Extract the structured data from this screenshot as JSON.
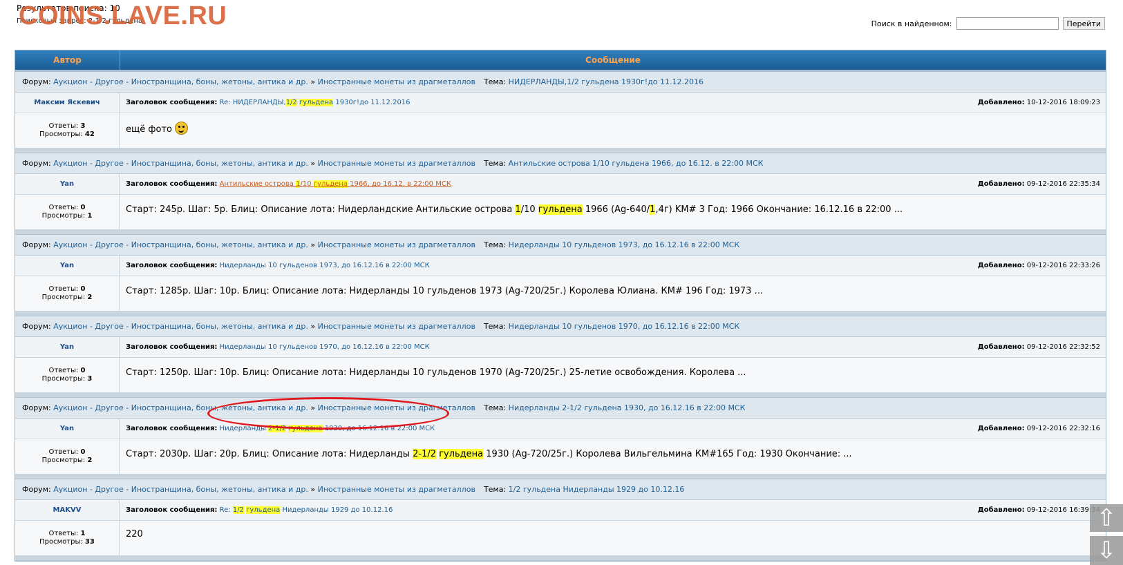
{
  "watermark": "COINS.LAVE.RU",
  "top": {
    "results": "Результатов поиска: 10",
    "query": "Поисковый запрос: 2-1/2 гульдена",
    "search_label": "Поиск в найденном:",
    "search_value": "",
    "search_button": "Перейти"
  },
  "table": {
    "col_author": "Автор",
    "col_message": "Сообщение"
  },
  "labels": {
    "forum": "Форум:",
    "topic": "Тема:",
    "subject": "Заголовок сообщения:",
    "added": "Добавлено:",
    "replies": "Ответы:",
    "views": "Просмотры:",
    "forum_path": "Аукцион - Другое - Иностранщина, боны, жетоны, антика и др.",
    "forum_sub": "Иностранные монеты из драгметаллов",
    "sep": "»"
  },
  "posts": [
    {
      "topic": "НИДЕРЛАНДЫ,1/2 гульдена 1930г!до 11.12.2016",
      "author": "Максим Яскевич",
      "subject_pre": "Re: НИДЕРЛАНДЫ,",
      "subject_hl1": "1/2",
      "subject_mid": " ",
      "subject_hl2": "гульдена",
      "subject_post": " 1930г!до 11.12.2016",
      "date": "10-12-2016 18:09:23",
      "replies": "3",
      "views": "42",
      "text": "ещё фото"
    },
    {
      "topic": "Антильские острова 1/10 гульдена 1966, до 16.12. в 22:00 МСК",
      "author": "Yan",
      "subject_a": "Антильские острова ",
      "subject_hl1": "1",
      "subject_b": "/10 ",
      "subject_hl2": "гульдена",
      "subject_c": " 1966, до 16.12. в 22:00 МСК",
      "date": "09-12-2016 22:35:34",
      "replies": "0",
      "views": "1",
      "text_a": "Старт: 245р. Шаг: 5р. Блиц: Описание лота: Нидерландские Антильские острова ",
      "text_hl1": "1",
      "text_b": "/10 ",
      "text_hl2": "гульдена",
      "text_c": " 1966 (Ag-640/",
      "text_hl3": "1",
      "text_d": ",4г) KM# 3 Год: 1966 Окончание: 16.12.16 в 22:00 ..."
    },
    {
      "topic": "Нидерланды 10 гульденов 1973, до 16.12.16 в 22:00 МСК",
      "author": "Yan",
      "subject": "Нидерланды 10 гульденов 1973, до 16.12.16 в 22:00 МСК",
      "date": "09-12-2016 22:33:26",
      "replies": "0",
      "views": "2",
      "text": "Старт: 1285р. Шаг: 10р. Блиц: Описание лота: Нидерланды 10 гульденов 1973 (Ag-720/25г.) Королева Юлиана. КМ# 196 Год: 1973 ..."
    },
    {
      "topic": "Нидерланды 10 гульденов 1970, до 16.12.16 в 22:00 МСК",
      "author": "Yan",
      "subject": "Нидерланды 10 гульденов 1970, до 16.12.16 в 22:00 МСК",
      "date": "09-12-2016 22:32:52",
      "replies": "0",
      "views": "3",
      "text": "Старт: 1250р. Шаг: 10р. Блиц: Описание лота: Нидерланды 10 гульденов 1970 (Ag-720/25г.) 25-летие освобождения. Королева ..."
    },
    {
      "topic": "Нидерланды 2-1/2 гульдена 1930, до 16.12.16 в 22:00 МСК",
      "author": "Yan",
      "subject_pre": "Нидерланды ",
      "subject_hl1": "2-1/2",
      "subject_mid": " ",
      "subject_hl2": "гульдена",
      "subject_post": " 1930, до 16.12.16 в 22:00 МСК",
      "date": "09-12-2016 22:32:16",
      "replies": "0",
      "views": "2",
      "text_pre": "Старт: 2030р. Шаг: 20р. Блиц: Описание лота: Нидерланды ",
      "text_hl1": "2-1/2",
      "text_mid": " ",
      "text_hl2": "гульдена",
      "text_post": " 1930 (Ag-720/25г.) Королева Вильгельмина КМ#165 Год: 1930 Окончание: ..."
    },
    {
      "topic": "1/2 гульдена Нидерланды 1929 до 10.12.16",
      "author": "MAKVV",
      "subject_pre": "Re: ",
      "subject_hl1": "1/2",
      "subject_mid": " ",
      "subject_hl2": "гульдена",
      "subject_post": " Нидерланды 1929 до 10.12.16",
      "date": "09-12-2016 16:39:34",
      "replies": "1",
      "views": "33",
      "text": "220"
    }
  ]
}
